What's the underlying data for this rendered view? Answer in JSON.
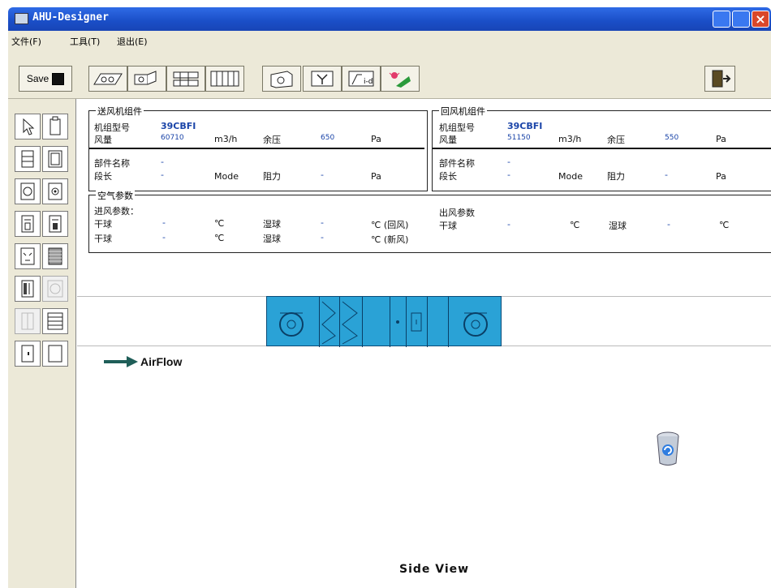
{
  "window": {
    "title": "AHU-Designer"
  },
  "menu": [
    "文件(F)",
    "工具(T)",
    "退出(E)"
  ],
  "toolbar": {
    "save_label": "Save"
  },
  "supply_group": {
    "title": "送风机组件",
    "model_label": "机组型号",
    "model_value": "39CBFI",
    "airflow_label": "风量",
    "airflow_value": "60710",
    "airflow_unit": "m3/h",
    "pressure_label": "余压",
    "pressure_value": "650",
    "pressure_unit": "Pa",
    "part_name_label": "部件名称",
    "part_name_value": "-",
    "section_len_label": "段长",
    "section_len_value": "-",
    "mode_label": "Mode",
    "resistance_label": "阻力",
    "resistance_value": "-",
    "resistance_unit": "Pa"
  },
  "return_group": {
    "title": "回风机组件",
    "model_label": "机组型号",
    "model_value": "39CBFI",
    "airflow_label": "风量",
    "airflow_value": "51150",
    "airflow_unit": "m3/h",
    "pressure_label": "余压",
    "pressure_value": "550",
    "pressure_unit": "Pa",
    "part_name_label": "部件名称",
    "part_name_value": "-",
    "section_len_label": "段长",
    "section_len_value": "-",
    "mode_label": "Mode",
    "resistance_label": "阻力",
    "resistance_value": "-",
    "resistance_unit": "Pa"
  },
  "air_params": {
    "title": "空气参数",
    "inlet_label": "进风参数：",
    "drybulb_label": "干球",
    "wetbulb_label": "湿球",
    "dash": "-",
    "unit_c": "℃",
    "return_air": "℃ (回风)",
    "fresh_air": "℃ (新风)",
    "outlet_label": "出风参数",
    "out_dry_label": "干球",
    "out_wet_label": "湿球"
  },
  "canvas": {
    "airflow_label": "AirFlow",
    "view_label": "Side View"
  },
  "colors": {
    "unit_fill": "#2aa2d6",
    "titlebar": "#1a4ec7",
    "text_blue": "#1a44a8"
  }
}
